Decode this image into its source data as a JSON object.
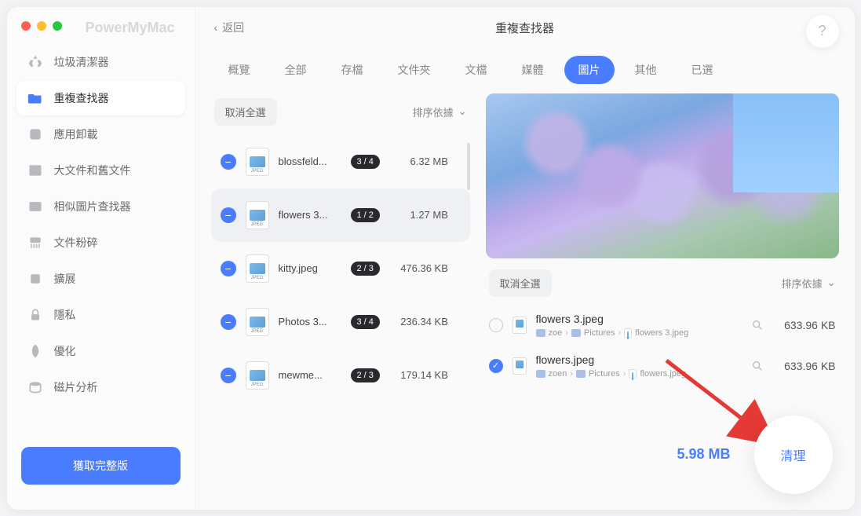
{
  "app_name": "PowerMyMac",
  "header": {
    "back": "返回",
    "title": "重複查找器",
    "help": "?"
  },
  "sidebar": {
    "items": [
      {
        "label": "垃圾清潔器"
      },
      {
        "label": "重複查找器"
      },
      {
        "label": "應用卸載"
      },
      {
        "label": "大文件和舊文件"
      },
      {
        "label": "相似圖片查找器"
      },
      {
        "label": "文件粉碎"
      },
      {
        "label": "擴展"
      },
      {
        "label": "隱私"
      },
      {
        "label": "優化"
      },
      {
        "label": "磁片分析"
      }
    ],
    "get_full": "獲取完整版"
  },
  "tabs": {
    "items": [
      "概覽",
      "全部",
      "存檔",
      "文件夾",
      "文檔",
      "媒體",
      "圖片",
      "其他",
      "已選"
    ],
    "active_index": 6
  },
  "toolbar": {
    "deselect": "取消全選",
    "sort": "排序依據"
  },
  "files": [
    {
      "name": "blossfeld...",
      "badge": "3 / 4",
      "size": "6.32 MB"
    },
    {
      "name": "flowers 3...",
      "badge": "1 / 2",
      "size": "1.27 MB"
    },
    {
      "name": "kitty.jpeg",
      "badge": "2 / 3",
      "size": "476.36 KB"
    },
    {
      "name": "Photos 3...",
      "badge": "3 / 4",
      "size": "236.34 KB"
    },
    {
      "name": "mewme...",
      "badge": "2 / 3",
      "size": "179.14 KB"
    }
  ],
  "details": [
    {
      "checked": false,
      "name": "flowers 3.jpeg",
      "path_user": "zoe",
      "path_folder": "Pictures",
      "path_file": "flowers 3.jpeg",
      "size": "633.96 KB"
    },
    {
      "checked": true,
      "name": "flowers.jpeg",
      "path_user": "zoen",
      "path_folder": "Pictures",
      "path_file": "flowers.jpeg",
      "size": "633.96 KB"
    }
  ],
  "footer": {
    "total": "5.98 MB",
    "clean": "清理"
  }
}
